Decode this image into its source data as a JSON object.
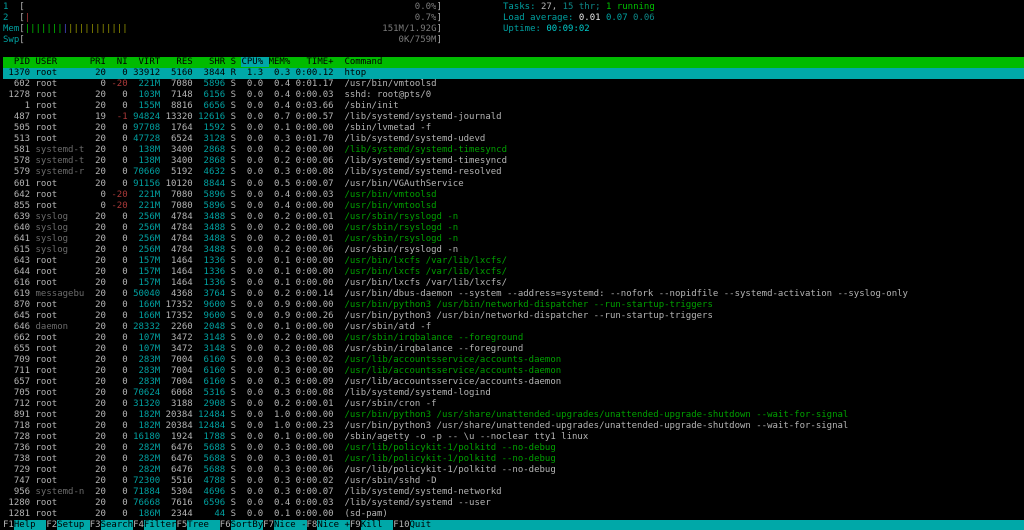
{
  "colors": {
    "bg": "#000000",
    "fg": "#b4b4b4",
    "white": "#e6e6e6",
    "shadow": "#6b6b6b",
    "cyan": "#00a0a0",
    "teal": "#0e8888",
    "bright_cyan": "#00c8c8",
    "green": "#00a000",
    "bright_green": "#00c000",
    "red": "#a83838",
    "blue": "#4848d0",
    "yellow": "#949400",
    "header_bg": "#00bb00",
    "sel_bg": "#00a8a8",
    "fkey_bg": "#00a8a8",
    "meter_text": "#7a7a7a"
  },
  "meters": [
    {
      "name": "cpu1-meter",
      "label": "1",
      "value": "0.0%",
      "ticks": []
    },
    {
      "name": "cpu2-meter",
      "label": "2",
      "value": "0.7%",
      "ticks": [
        {
          "color": "red",
          "count": 1
        }
      ]
    },
    {
      "name": "memory-meter",
      "label": "Mem",
      "value": "151M/1.92G",
      "ticks": [
        {
          "color": "bright_green",
          "count": 7
        },
        {
          "color": "blue",
          "count": 1
        },
        {
          "color": "yellow",
          "count": 11
        }
      ]
    },
    {
      "name": "swap-meter",
      "label": "Swp",
      "value": "0K/759M",
      "ticks": []
    }
  ],
  "header_right": [
    {
      "name": "tasks-summary",
      "segments": [
        [
          "Tasks: ",
          "cyan"
        ],
        [
          "27, ",
          "fg"
        ],
        [
          "15 thr",
          "teal"
        ],
        [
          "; ",
          "teal"
        ],
        [
          "1 running",
          "bright_green"
        ]
      ]
    },
    {
      "name": "load-average",
      "segments": [
        [
          "Load average: ",
          "cyan"
        ],
        [
          "0.01 ",
          "white"
        ],
        [
          "0.07 ",
          "cyan"
        ],
        [
          "0.06",
          "teal"
        ]
      ]
    },
    {
      "name": "uptime",
      "segments": [
        [
          "Uptime: ",
          "cyan"
        ],
        [
          "00:09:02",
          "bright_cyan"
        ]
      ]
    }
  ],
  "table": {
    "columns": [
      "PID",
      "USER",
      "PRI",
      "NI",
      "VIRT",
      "RES",
      "SHR",
      "S",
      "CPU%",
      "MEM%",
      "TIME+",
      "Command"
    ],
    "sort_column": "CPU%",
    "rows": [
      [
        "1370",
        "root",
        "20",
        "0",
        "33912",
        "5160",
        "3844",
        "R",
        "1.3",
        "0.3",
        "0:00.12",
        "htop",
        "sel"
      ],
      [
        "602",
        "root",
        "0",
        "-20",
        "221M",
        "7080",
        "5896",
        "S",
        "0.0",
        "0.4",
        "0:01.17",
        "/usr/bin/vmtoolsd",
        ""
      ],
      [
        "1278",
        "root",
        "20",
        "0",
        "103M",
        "7148",
        "6156",
        "S",
        "0.0",
        "0.4",
        "0:00.03",
        "sshd: root@pts/0",
        ""
      ],
      [
        "1",
        "root",
        "20",
        "0",
        "155M",
        "8816",
        "6656",
        "S",
        "0.0",
        "0.4",
        "0:03.66",
        "/sbin/init",
        ""
      ],
      [
        "487",
        "root",
        "19",
        "-1",
        "94824",
        "13320",
        "12616",
        "S",
        "0.0",
        "0.7",
        "0:00.57",
        "/lib/systemd/systemd-journald",
        ""
      ],
      [
        "505",
        "root",
        "20",
        "0",
        "97708",
        "1764",
        "1592",
        "S",
        "0.0",
        "0.1",
        "0:00.00",
        "/sbin/lvmetad -f",
        ""
      ],
      [
        "513",
        "root",
        "20",
        "0",
        "47728",
        "6524",
        "3128",
        "S",
        "0.0",
        "0.3",
        "0:01.70",
        "/lib/systemd/systemd-udevd",
        ""
      ],
      [
        "581",
        "systemd-t",
        "20",
        "0",
        "138M",
        "3400",
        "2868",
        "S",
        "0.0",
        "0.2",
        "0:00.00",
        "/lib/systemd/systemd-timesyncd",
        "g"
      ],
      [
        "578",
        "systemd-t",
        "20",
        "0",
        "138M",
        "3400",
        "2868",
        "S",
        "0.0",
        "0.2",
        "0:00.06",
        "/lib/systemd/systemd-timesyncd",
        ""
      ],
      [
        "579",
        "systemd-r",
        "20",
        "0",
        "70660",
        "5192",
        "4632",
        "S",
        "0.0",
        "0.3",
        "0:00.08",
        "/lib/systemd/systemd-resolved",
        ""
      ],
      [
        "601",
        "root",
        "20",
        "0",
        "91156",
        "10120",
        "8844",
        "S",
        "0.0",
        "0.5",
        "0:00.07",
        "/usr/bin/VGAuthService",
        ""
      ],
      [
        "642",
        "root",
        "0",
        "-20",
        "221M",
        "7080",
        "5896",
        "S",
        "0.0",
        "0.4",
        "0:00.03",
        "/usr/bin/vmtoolsd",
        "g"
      ],
      [
        "855",
        "root",
        "0",
        "-20",
        "221M",
        "7080",
        "5896",
        "S",
        "0.0",
        "0.4",
        "0:00.00",
        "/usr/bin/vmtoolsd",
        "g"
      ],
      [
        "639",
        "syslog",
        "20",
        "0",
        "256M",
        "4784",
        "3488",
        "S",
        "0.0",
        "0.2",
        "0:00.01",
        "/usr/sbin/rsyslogd -n",
        "g"
      ],
      [
        "640",
        "syslog",
        "20",
        "0",
        "256M",
        "4784",
        "3488",
        "S",
        "0.0",
        "0.2",
        "0:00.00",
        "/usr/sbin/rsyslogd -n",
        "g"
      ],
      [
        "641",
        "syslog",
        "20",
        "0",
        "256M",
        "4784",
        "3488",
        "S",
        "0.0",
        "0.2",
        "0:00.01",
        "/usr/sbin/rsyslogd -n",
        "g"
      ],
      [
        "615",
        "syslog",
        "20",
        "0",
        "256M",
        "4784",
        "3488",
        "S",
        "0.0",
        "0.2",
        "0:00.06",
        "/usr/sbin/rsyslogd -n",
        ""
      ],
      [
        "643",
        "root",
        "20",
        "0",
        "157M",
        "1464",
        "1336",
        "S",
        "0.0",
        "0.1",
        "0:00.00",
        "/usr/bin/lxcfs /var/lib/lxcfs/",
        "g"
      ],
      [
        "644",
        "root",
        "20",
        "0",
        "157M",
        "1464",
        "1336",
        "S",
        "0.0",
        "0.1",
        "0:00.00",
        "/usr/bin/lxcfs /var/lib/lxcfs/",
        "g"
      ],
      [
        "616",
        "root",
        "20",
        "0",
        "157M",
        "1464",
        "1336",
        "S",
        "0.0",
        "0.1",
        "0:00.00",
        "/usr/bin/lxcfs /var/lib/lxcfs/",
        ""
      ],
      [
        "619",
        "messagebu",
        "20",
        "0",
        "50040",
        "4368",
        "3764",
        "S",
        "0.0",
        "0.2",
        "0:00.14",
        "/usr/bin/dbus-daemon --system --address=systemd: --nofork --nopidfile --systemd-activation --syslog-only",
        ""
      ],
      [
        "870",
        "root",
        "20",
        "0",
        "166M",
        "17352",
        "9600",
        "S",
        "0.0",
        "0.9",
        "0:00.00",
        "/usr/bin/python3 /usr/bin/networkd-dispatcher --run-startup-triggers",
        "g"
      ],
      [
        "645",
        "root",
        "20",
        "0",
        "166M",
        "17352",
        "9600",
        "S",
        "0.0",
        "0.9",
        "0:00.26",
        "/usr/bin/python3 /usr/bin/networkd-dispatcher --run-startup-triggers",
        ""
      ],
      [
        "646",
        "daemon",
        "20",
        "0",
        "28332",
        "2260",
        "2048",
        "S",
        "0.0",
        "0.1",
        "0:00.00",
        "/usr/sbin/atd -f",
        ""
      ],
      [
        "662",
        "root",
        "20",
        "0",
        "107M",
        "3472",
        "3148",
        "S",
        "0.0",
        "0.2",
        "0:00.00",
        "/usr/sbin/irqbalance --foreground",
        "g"
      ],
      [
        "655",
        "root",
        "20",
        "0",
        "107M",
        "3472",
        "3148",
        "S",
        "0.0",
        "0.2",
        "0:00.08",
        "/usr/sbin/irqbalance --foreground",
        ""
      ],
      [
        "709",
        "root",
        "20",
        "0",
        "283M",
        "7004",
        "6160",
        "S",
        "0.0",
        "0.3",
        "0:00.02",
        "/usr/lib/accountsservice/accounts-daemon",
        "g"
      ],
      [
        "711",
        "root",
        "20",
        "0",
        "283M",
        "7004",
        "6160",
        "S",
        "0.0",
        "0.3",
        "0:00.00",
        "/usr/lib/accountsservice/accounts-daemon",
        "g"
      ],
      [
        "657",
        "root",
        "20",
        "0",
        "283M",
        "7004",
        "6160",
        "S",
        "0.0",
        "0.3",
        "0:00.09",
        "/usr/lib/accountsservice/accounts-daemon",
        ""
      ],
      [
        "705",
        "root",
        "20",
        "0",
        "70624",
        "6068",
        "5316",
        "S",
        "0.0",
        "0.3",
        "0:00.08",
        "/lib/systemd/systemd-logind",
        ""
      ],
      [
        "712",
        "root",
        "20",
        "0",
        "31320",
        "3188",
        "2908",
        "S",
        "0.0",
        "0.2",
        "0:00.01",
        "/usr/sbin/cron -f",
        ""
      ],
      [
        "891",
        "root",
        "20",
        "0",
        "182M",
        "20384",
        "12484",
        "S",
        "0.0",
        "1.0",
        "0:00.00",
        "/usr/bin/python3 /usr/share/unattended-upgrades/unattended-upgrade-shutdown --wait-for-signal",
        "g"
      ],
      [
        "718",
        "root",
        "20",
        "0",
        "182M",
        "20384",
        "12484",
        "S",
        "0.0",
        "1.0",
        "0:00.23",
        "/usr/bin/python3 /usr/share/unattended-upgrades/unattended-upgrade-shutdown --wait-for-signal",
        ""
      ],
      [
        "728",
        "root",
        "20",
        "0",
        "16180",
        "1924",
        "1788",
        "S",
        "0.0",
        "0.1",
        "0:00.00",
        "/sbin/agetty -o -p -- \\u --noclear tty1 linux",
        ""
      ],
      [
        "736",
        "root",
        "20",
        "0",
        "282M",
        "6476",
        "5688",
        "S",
        "0.0",
        "0.3",
        "0:00.00",
        "/usr/lib/policykit-1/polkitd --no-debug",
        "g"
      ],
      [
        "738",
        "root",
        "20",
        "0",
        "282M",
        "6476",
        "5688",
        "S",
        "0.0",
        "0.3",
        "0:00.01",
        "/usr/lib/policykit-1/polkitd --no-debug",
        "g"
      ],
      [
        "729",
        "root",
        "20",
        "0",
        "282M",
        "6476",
        "5688",
        "S",
        "0.0",
        "0.3",
        "0:00.06",
        "/usr/lib/policykit-1/polkitd --no-debug",
        ""
      ],
      [
        "747",
        "root",
        "20",
        "0",
        "72300",
        "5516",
        "4788",
        "S",
        "0.0",
        "0.3",
        "0:00.02",
        "/usr/sbin/sshd -D",
        ""
      ],
      [
        "956",
        "systemd-n",
        "20",
        "0",
        "71884",
        "5304",
        "4696",
        "S",
        "0.0",
        "0.3",
        "0:00.07",
        "/lib/systemd/systemd-networkd",
        ""
      ],
      [
        "1280",
        "root",
        "20",
        "0",
        "76668",
        "7616",
        "6596",
        "S",
        "0.0",
        "0.4",
        "0:00.03",
        "/lib/systemd/systemd --user",
        ""
      ],
      [
        "1281",
        "root",
        "20",
        "0",
        "186M",
        "2344",
        "44",
        "S",
        "0.0",
        "0.1",
        "0:00.00",
        "(sd-pam)",
        ""
      ]
    ]
  },
  "fkeys": [
    {
      "key": "F1",
      "label": "Help"
    },
    {
      "key": "F2",
      "label": "Setup"
    },
    {
      "key": "F3",
      "label": "Search"
    },
    {
      "key": "F4",
      "label": "Filter"
    },
    {
      "key": "F5",
      "label": "Tree"
    },
    {
      "key": "F6",
      "label": "SortBy"
    },
    {
      "key": "F7",
      "label": "Nice -"
    },
    {
      "key": "F8",
      "label": "Nice +"
    },
    {
      "key": "F9",
      "label": "Kill"
    },
    {
      "key": "F10",
      "label": "Quit"
    }
  ]
}
